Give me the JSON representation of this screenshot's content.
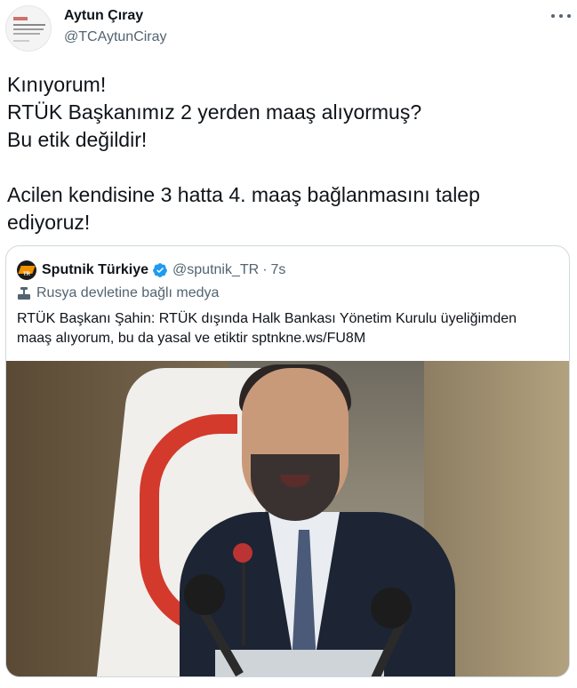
{
  "author": {
    "display_name": "Aytun Çıray",
    "handle": "@TCAytunCiray"
  },
  "tweet": {
    "lines": [
      "Kınıyorum!",
      "RTÜK Başkanımız 2 yerden maaş alıyormuş?",
      "Bu etik değildir!",
      "",
      "Acilen kendisine 3 hatta 4. maaş bağlanmasını talep",
      "ediyoruz!"
    ]
  },
  "quoted": {
    "name": "Sputnik Türkiye",
    "handle": "@sputnik_TR",
    "separator": "·",
    "time": "7s",
    "label": "Rusya devletine bağlı medya",
    "text_lines": [
      "RTÜK Başkanı Şahin: RTÜK dışında Halk Bankası Yönetim Kurulu üyeliğimden",
      "maaş alıyorum, bu da yasal ve etiktir sptnkne.ws/FU8M"
    ]
  },
  "colors": {
    "verified_blue": "#1d9bf0",
    "secondary_text": "#536471",
    "border": "#cfd9de"
  },
  "icons": [
    "more-icon",
    "verified-badge-icon",
    "state-media-icon"
  ]
}
